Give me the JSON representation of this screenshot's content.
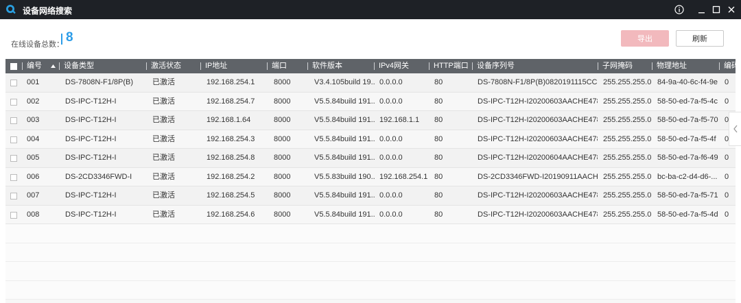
{
  "window": {
    "title": "设备网络搜索",
    "logo_icon": "search-globe-icon",
    "buttons": [
      "info-icon",
      "minimize-icon",
      "maximize-icon",
      "close-icon"
    ]
  },
  "summary": {
    "online_label": "在线设备总数：",
    "online_count": "8"
  },
  "toolbar": {
    "export_label": "导出",
    "refresh_label": "刷新"
  },
  "table": {
    "headers": [
      "编号",
      "设备类型",
      "激活状态",
      "IP地址",
      "端口",
      "软件版本",
      "IPv4网关",
      "HTTP端口",
      "设备序列号",
      "子网掩码",
      "物理地址",
      "编码"
    ],
    "rows": [
      {
        "no": "001",
        "type": "DS-7808N-F1/8P(B)",
        "status": "已激活",
        "ip": "192.168.254.1",
        "port": "8000",
        "ver": "V3.4.105build 19...",
        "gw": "0.0.0.0",
        "http": "80",
        "serial": "DS-7808N-F1/8P(B)0820191115CCR...",
        "mask": "255.255.255.0",
        "mac": "84-9a-40-6c-f4-9e",
        "enc": "0"
      },
      {
        "no": "002",
        "type": "DS-IPC-T12H-I",
        "status": "已激活",
        "ip": "192.168.254.7",
        "port": "8000",
        "ver": "V5.5.84build 191...",
        "gw": "0.0.0.0",
        "http": "80",
        "serial": "DS-IPC-T12H-I20200603AACHE478...",
        "mask": "255.255.255.0",
        "mac": "58-50-ed-7a-f5-4c",
        "enc": "0"
      },
      {
        "no": "003",
        "type": "DS-IPC-T12H-I",
        "status": "已激活",
        "ip": "192.168.1.64",
        "port": "8000",
        "ver": "V5.5.84build 191...",
        "gw": "192.168.1.1",
        "http": "80",
        "serial": "DS-IPC-T12H-I20200603AACHE478...",
        "mask": "255.255.255.0",
        "mac": "58-50-ed-7a-f5-70",
        "enc": "0"
      },
      {
        "no": "004",
        "type": "DS-IPC-T12H-I",
        "status": "已激活",
        "ip": "192.168.254.3",
        "port": "8000",
        "ver": "V5.5.84build 191...",
        "gw": "0.0.0.0",
        "http": "80",
        "serial": "DS-IPC-T12H-I20200603AACHE478...",
        "mask": "255.255.255.0",
        "mac": "58-50-ed-7a-f5-4f",
        "enc": "0"
      },
      {
        "no": "005",
        "type": "DS-IPC-T12H-I",
        "status": "已激活",
        "ip": "192.168.254.8",
        "port": "8000",
        "ver": "V5.5.84build 191...",
        "gw": "0.0.0.0",
        "http": "80",
        "serial": "DS-IPC-T12H-I20200604AACHE478...",
        "mask": "255.255.255.0",
        "mac": "58-50-ed-7a-f6-49",
        "enc": "0"
      },
      {
        "no": "006",
        "type": "DS-2CD3346FWD-I",
        "status": "已激活",
        "ip": "192.168.254.2",
        "port": "8000",
        "ver": "V5.5.83build 190...",
        "gw": "192.168.254.1",
        "http": "80",
        "serial": "DS-2CD3346FWD-I20190911AACHD...",
        "mask": "255.255.255.0",
        "mac": "bc-ba-c2-d4-d6-...",
        "enc": "0"
      },
      {
        "no": "007",
        "type": "DS-IPC-T12H-I",
        "status": "已激活",
        "ip": "192.168.254.5",
        "port": "8000",
        "ver": "V5.5.84build 191...",
        "gw": "0.0.0.0",
        "http": "80",
        "serial": "DS-IPC-T12H-I20200603AACHE478...",
        "mask": "255.255.255.0",
        "mac": "58-50-ed-7a-f5-71",
        "enc": "0"
      },
      {
        "no": "008",
        "type": "DS-IPC-T12H-I",
        "status": "已激活",
        "ip": "192.168.254.6",
        "port": "8000",
        "ver": "V5.5.84build 191...",
        "gw": "0.0.0.0",
        "http": "80",
        "serial": "DS-IPC-T12H-I20200603AACHE478...",
        "mask": "255.255.255.0",
        "mac": "58-50-ed-7a-f5-4d",
        "enc": "0"
      }
    ]
  },
  "colors": {
    "titlebar": "#1e2126",
    "header_row": "#5f6368",
    "accent": "#2b9ce8",
    "export_disabled": "#f2b9bd"
  }
}
